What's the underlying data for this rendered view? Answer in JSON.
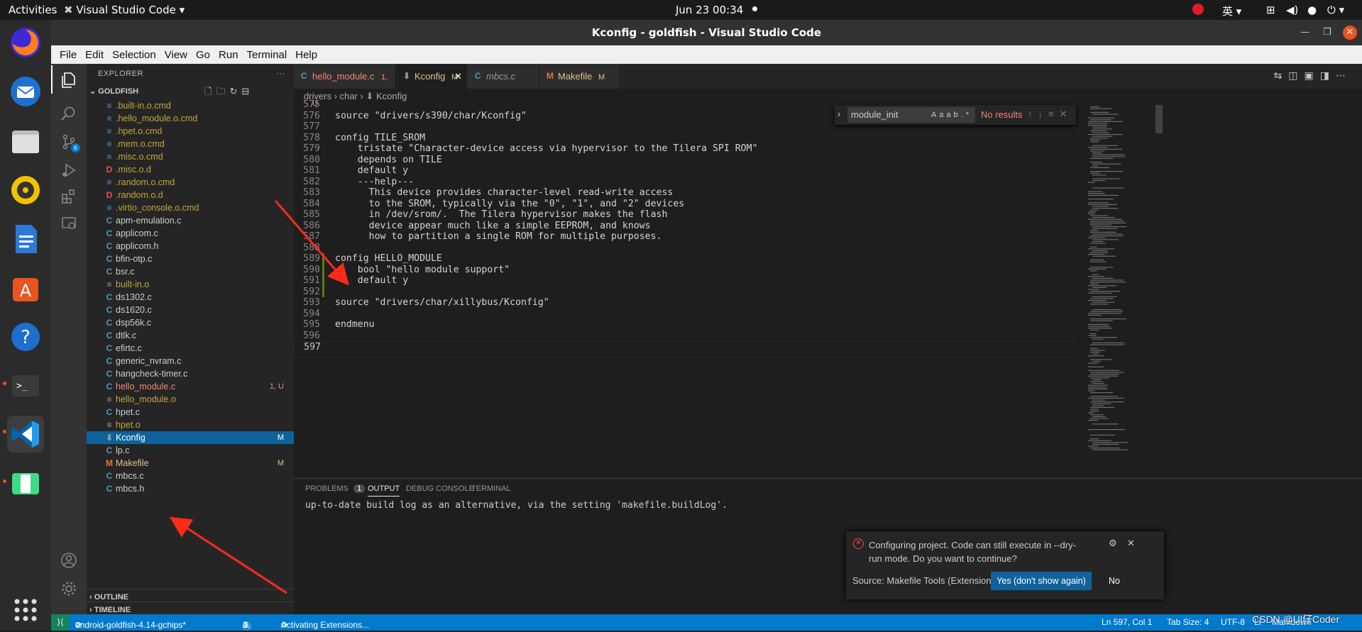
{
  "topbar": {
    "activities": "Activities",
    "app_name": "Visual Studio Code",
    "clock": "Jun 23  00:34",
    "input_method": "英"
  },
  "window": {
    "title": "Kconfig - goldfish - Visual Studio Code"
  },
  "menu": [
    "File",
    "Edit",
    "Selection",
    "View",
    "Go",
    "Run",
    "Terminal",
    "Help"
  ],
  "explorer": {
    "header": "EXPLORER",
    "folder": "GOLDFISH",
    "files": [
      {
        "name": ".built-in.o.cmd",
        "icon": "≡",
        "color": "#c5a53a",
        "badge": ""
      },
      {
        "name": ".hello_module.o.cmd",
        "icon": "≡",
        "color": "#c5a53a",
        "badge": ""
      },
      {
        "name": ".hpet.o.cmd",
        "icon": "≡",
        "color": "#c5a53a",
        "badge": ""
      },
      {
        "name": ".mem.o.cmd",
        "icon": "≡",
        "color": "#c5a53a",
        "badge": ""
      },
      {
        "name": ".misc.o.cmd",
        "icon": "≡",
        "color": "#c5a53a",
        "badge": ""
      },
      {
        "name": ".misc.o.d",
        "icon": "D",
        "color": "#c5a53a",
        "badge": ""
      },
      {
        "name": ".random.o.cmd",
        "icon": "≡",
        "color": "#c5a53a",
        "badge": ""
      },
      {
        "name": ".random.o.d",
        "icon": "D",
        "color": "#c5a53a",
        "badge": ""
      },
      {
        "name": ".virtio_console.o.cmd",
        "icon": "≡",
        "color": "#c5a53a",
        "badge": ""
      },
      {
        "name": "apm-emulation.c",
        "icon": "C",
        "color": "#cccccc",
        "badge": ""
      },
      {
        "name": "applicom.c",
        "icon": "C",
        "color": "#cccccc",
        "badge": ""
      },
      {
        "name": "applicom.h",
        "icon": "C",
        "color": "#cccccc",
        "badge": ""
      },
      {
        "name": "bfin-otp.c",
        "icon": "C",
        "color": "#cccccc",
        "badge": ""
      },
      {
        "name": "bsr.c",
        "icon": "C",
        "color": "#cccccc",
        "badge": ""
      },
      {
        "name": "built-in.o",
        "icon": "≡",
        "color": "#c5a53a",
        "badge": ""
      },
      {
        "name": "ds1302.c",
        "icon": "C",
        "color": "#cccccc",
        "badge": ""
      },
      {
        "name": "ds1620.c",
        "icon": "C",
        "color": "#cccccc",
        "badge": ""
      },
      {
        "name": "dsp56k.c",
        "icon": "C",
        "color": "#cccccc",
        "badge": ""
      },
      {
        "name": "dtlk.c",
        "icon": "C",
        "color": "#cccccc",
        "badge": ""
      },
      {
        "name": "efirtc.c",
        "icon": "C",
        "color": "#cccccc",
        "badge": ""
      },
      {
        "name": "generic_nvram.c",
        "icon": "C",
        "color": "#cccccc",
        "badge": ""
      },
      {
        "name": "hangcheck-timer.c",
        "icon": "C",
        "color": "#cccccc",
        "badge": ""
      },
      {
        "name": "hello_module.c",
        "icon": "C",
        "color": "#f48771",
        "badge": "1, U"
      },
      {
        "name": "hello_module.o",
        "icon": "≡",
        "color": "#c5a53a",
        "badge": ""
      },
      {
        "name": "hpet.c",
        "icon": "C",
        "color": "#cccccc",
        "badge": ""
      },
      {
        "name": "hpet.o",
        "icon": "≡",
        "color": "#c5a53a",
        "badge": ""
      },
      {
        "name": "Kconfig",
        "icon": "⬇",
        "color": "#ffffff",
        "badge": "M"
      },
      {
        "name": "lp.c",
        "icon": "C",
        "color": "#cccccc",
        "badge": ""
      },
      {
        "name": "Makefile",
        "icon": "M",
        "color": "#e2c08d",
        "badge": "M"
      },
      {
        "name": "mbcs.c",
        "icon": "C",
        "color": "#cccccc",
        "badge": ""
      },
      {
        "name": "mbcs.h",
        "icon": "C",
        "color": "#cccccc",
        "badge": ""
      }
    ],
    "outline": "OUTLINE",
    "timeline": "TIMELINE"
  },
  "tabs": [
    {
      "label": "hello_module.c",
      "badge": "1, U",
      "icon": "C",
      "color": "#f48771"
    },
    {
      "label": "Kconfig",
      "badge": "M",
      "icon": "⬇",
      "color": "#ffffff"
    },
    {
      "label": "mbcs.c",
      "badge": "",
      "icon": "C",
      "color": "#9d9d9d"
    },
    {
      "label": "Makefile",
      "badge": "M",
      "icon": "M",
      "color": "#e2c08d"
    }
  ],
  "breadcrumb": [
    "drivers",
    "char",
    "Kconfig"
  ],
  "find": {
    "query": "module_init",
    "result": "No results",
    "opt_case": "Aa",
    "opt_word": "ab",
    "opt_regex": ".*"
  },
  "code": [
    {
      "n": "575",
      "t": ""
    },
    {
      "n": "576",
      "t": "source \"drivers/s390/char/Kconfig\""
    },
    {
      "n": "577",
      "t": ""
    },
    {
      "n": "578",
      "t": "config TILE_SROM"
    },
    {
      "n": "579",
      "t": "    tristate \"Character-device access via hypervisor to the Tilera SPI ROM\""
    },
    {
      "n": "580",
      "t": "    depends on TILE"
    },
    {
      "n": "581",
      "t": "    default y"
    },
    {
      "n": "582",
      "t": "    ---help---"
    },
    {
      "n": "583",
      "t": "      This device provides character-level read-write access"
    },
    {
      "n": "584",
      "t": "      to the SROM, typically via the \"0\", \"1\", and \"2\" devices"
    },
    {
      "n": "585",
      "t": "      in /dev/srom/.  The Tilera hypervisor makes the flash"
    },
    {
      "n": "586",
      "t": "      device appear much like a simple EEPROM, and knows"
    },
    {
      "n": "587",
      "t": "      how to partition a single ROM for multiple purposes."
    },
    {
      "n": "588",
      "t": ""
    },
    {
      "n": "589",
      "t": "config HELLO_MODULE"
    },
    {
      "n": "590",
      "t": "    bool \"hello module support\""
    },
    {
      "n": "591",
      "t": "    default y"
    },
    {
      "n": "592",
      "t": ""
    },
    {
      "n": "593",
      "t": "source \"drivers/char/xillybus/Kconfig\""
    },
    {
      "n": "594",
      "t": ""
    },
    {
      "n": "595",
      "t": "endmenu"
    },
    {
      "n": "596",
      "t": ""
    },
    {
      "n": "597",
      "t": ""
    }
  ],
  "panel": {
    "tabs": [
      "PROBLEMS",
      "OUTPUT",
      "DEBUG CONSOLE",
      "TERMINAL"
    ],
    "problems_count": "1",
    "output_text": "up-to-date build log as an alternative, via the setting 'makefile.buildLog'."
  },
  "notification": {
    "message": "Configuring project. Code can still execute in --dry-run mode. Do you want to continue?",
    "source": "Source: Makefile Tools (Extension)",
    "yes_label": "Yes (don't show again)",
    "no_label": "No"
  },
  "status": {
    "branch": "android-goldfish-4.14-gchips*",
    "errors": "1",
    "warnings": "0",
    "activity": "Activating Extensions...",
    "position": "Ln 597, Col 1",
    "tabsize": "Tab Size: 4",
    "encoding": "UTF-8",
    "eol": "LF",
    "language": "Markdown"
  },
  "watermark": "CSDN @Ul仔Coder",
  "colors": {
    "accent": "#007acc",
    "annotation_arrow": "#ff2a1a",
    "ubuntu_orange": "#e95420"
  }
}
